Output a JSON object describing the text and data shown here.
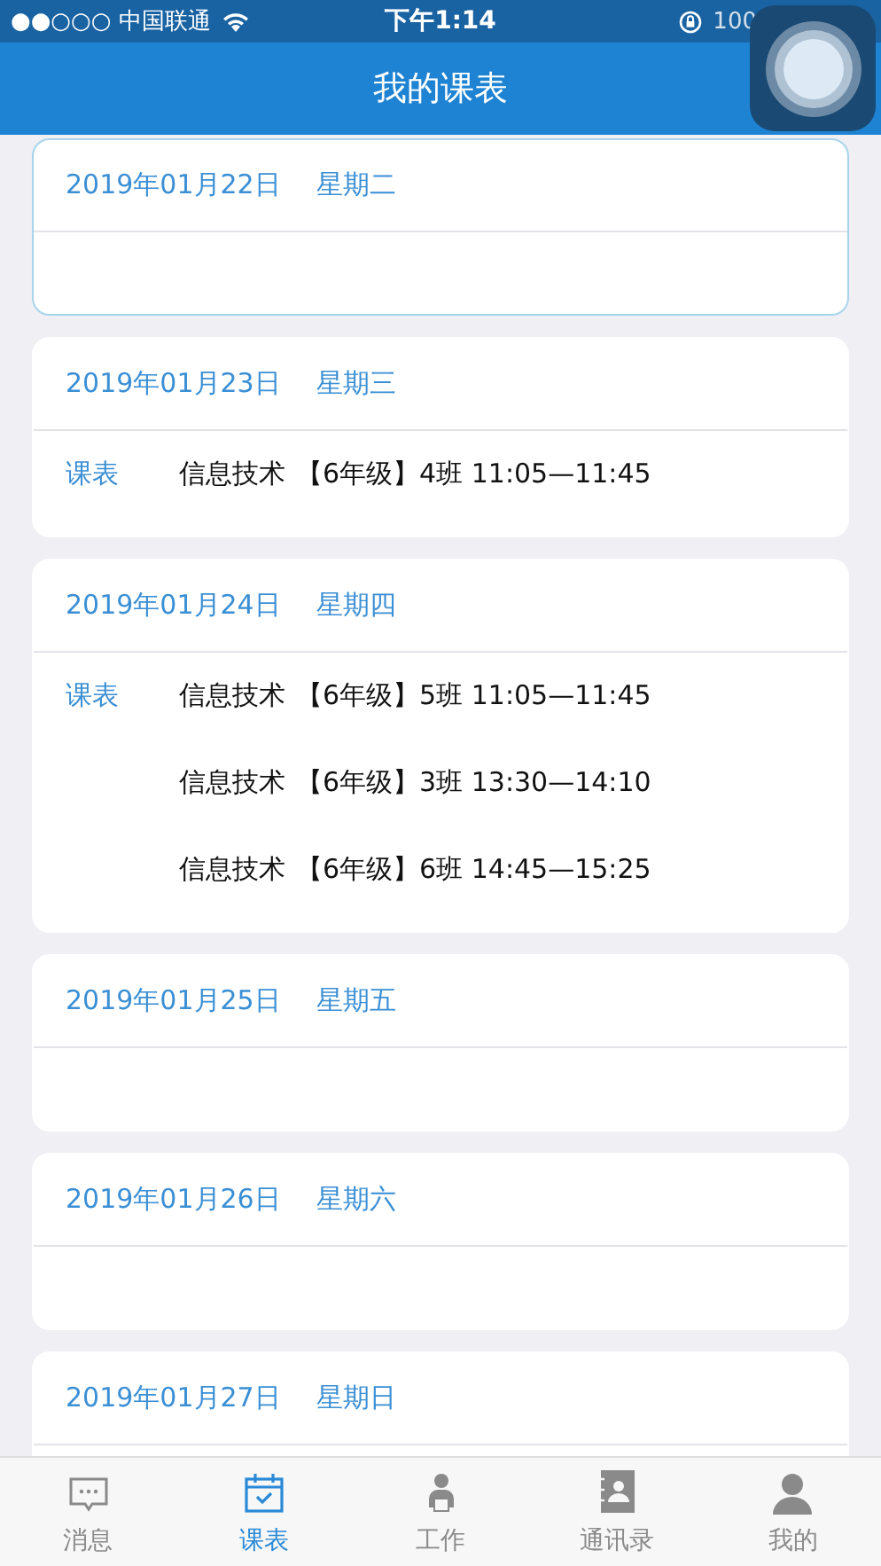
{
  "status_bar": {
    "carrier": "●●○○○ 中国联通",
    "time": "下午1:14",
    "battery": "100"
  },
  "nav_bar": {
    "title": "我的课表"
  },
  "days": [
    {
      "date": "2019年01月22日",
      "weekday": "星期二",
      "selected": true
    },
    {
      "date": "2019年01月23日",
      "weekday": "星期三",
      "selected": false,
      "label": "课表",
      "lessons": [
        {
          "subject": "信息技术",
          "detail": "【6年级】4班 11:05—11:45"
        }
      ]
    },
    {
      "date": "2019年01月24日",
      "weekday": "星期四",
      "selected": false,
      "label": "课表",
      "lessons": [
        {
          "subject": "信息技术",
          "detail": "【6年级】5班 11:05—11:45"
        },
        {
          "subject": "信息技术",
          "detail": "【6年级】3班 13:30—14:10"
        },
        {
          "subject": "信息技术",
          "detail": "【6年级】6班 14:45—15:25"
        }
      ]
    },
    {
      "date": "2019年01月25日",
      "weekday": "星期五",
      "selected": false
    },
    {
      "date": "2019年01月26日",
      "weekday": "星期六",
      "selected": false
    },
    {
      "date": "2019年01月27日",
      "weekday": "星期日",
      "selected": false
    }
  ],
  "tab_bar": [
    {
      "kind": "chat",
      "label": "消息",
      "selected": false
    },
    {
      "kind": "calendar",
      "label": "课表",
      "selected": true
    },
    {
      "kind": "worker",
      "label": "工作",
      "selected": false
    },
    {
      "kind": "contacts",
      "label": "通讯录",
      "selected": false
    },
    {
      "kind": "person",
      "label": "我的",
      "selected": false
    }
  ]
}
